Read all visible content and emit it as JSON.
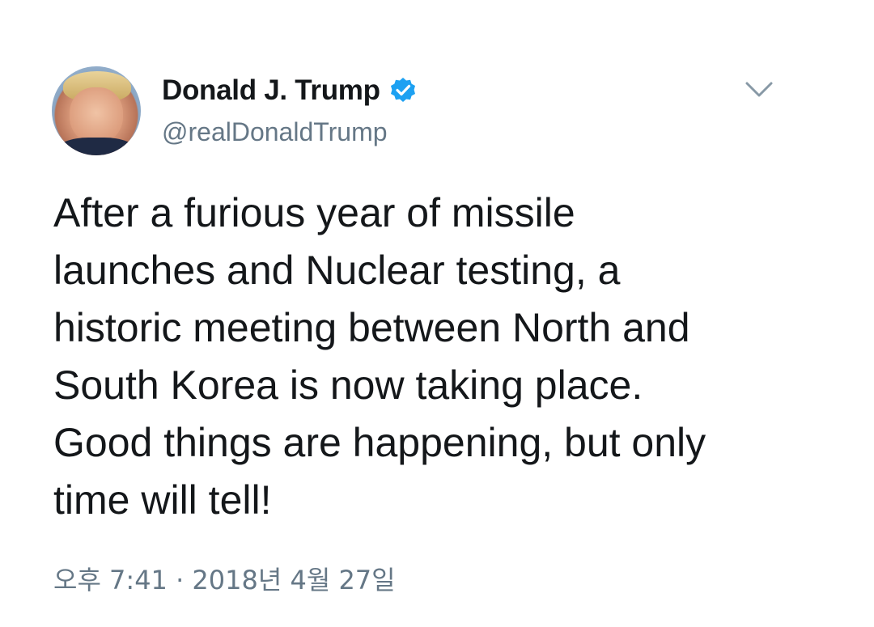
{
  "author": {
    "display_name": "Donald J. Trump",
    "handle": "@realDonaldTrump",
    "verified": true,
    "avatar_icon": "profile-photo",
    "verified_icon": "verified-badge-icon",
    "verified_color": "#1da1f2"
  },
  "menu": {
    "icon": "chevron-down-icon"
  },
  "tweet": {
    "text": "After a furious year of missile\nlaunches and Nuclear testing, a\nhistoric meeting between North and\nSouth Korea is now taking place.\nGood things are happening, but only\ntime will tell!",
    "timestamp": "오후 7:41 · 2018년 4월 27일"
  },
  "colors": {
    "text_primary": "#14171a",
    "text_secondary": "#657786",
    "accent": "#1da1f2"
  }
}
